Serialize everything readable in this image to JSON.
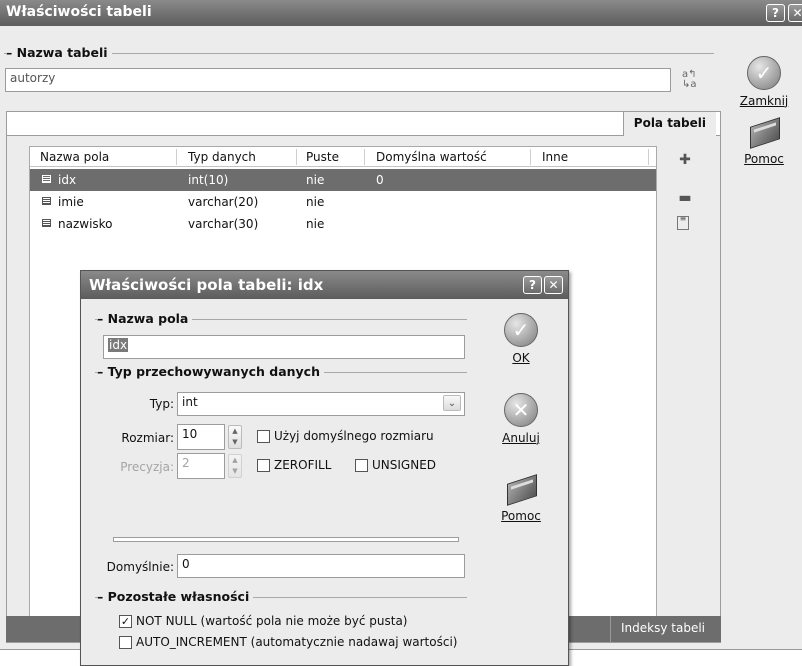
{
  "window": {
    "title": "Właściwości tabeli",
    "help_btn": "?",
    "close_btn": "✕"
  },
  "table_name": {
    "group_label": "Nazwa tabeli",
    "value": "autorzy"
  },
  "side_buttons": {
    "close_label": "Zamknij",
    "help_label": "Pomoc"
  },
  "fields_tab": {
    "tab_label": "Pola tabeli",
    "columns": [
      "Nazwa pola",
      "Typ danych",
      "Puste",
      "Domyślna wartość",
      "Inne"
    ],
    "rows": [
      {
        "name": "idx",
        "type": "int(10)",
        "null": "nie",
        "default": "0",
        "other": ""
      },
      {
        "name": "imie",
        "type": "varchar(20)",
        "null": "nie",
        "default": "",
        "other": ""
      },
      {
        "name": "nazwisko",
        "type": "varchar(30)",
        "null": "nie",
        "default": "",
        "other": ""
      }
    ],
    "selected_row": 0
  },
  "bottom_tab": {
    "label": "Indeksy tabeli"
  },
  "dialog": {
    "title": "Właściwości pola tabeli: idx",
    "help_btn": "?",
    "close_btn": "✕",
    "field_name_group": "Nazwa pola",
    "field_name_value": "idx",
    "type_group": "Typ przechowywanych danych",
    "type_label": "Typ:",
    "type_value": "int",
    "size_label": "Rozmiar:",
    "size_value": "10",
    "use_default_size": "Użyj domyślnego rozmiaru",
    "precision_label": "Precyzja:",
    "precision_value": "2",
    "zerofill": "ZEROFILL",
    "unsigned": "UNSIGNED",
    "default_label": "Domyślnie:",
    "default_value": "0",
    "other_group": "Pozostałe własności",
    "not_null": "NOT NULL (wartość pola nie może być pusta)",
    "not_null_checked": true,
    "auto_increment": "AUTO_INCREMENT (automatycznie nadawaj wartości)",
    "auto_increment_checked": false,
    "ok_label": "OK",
    "cancel_label": "Anuluj",
    "help_label": "Pomoc"
  }
}
